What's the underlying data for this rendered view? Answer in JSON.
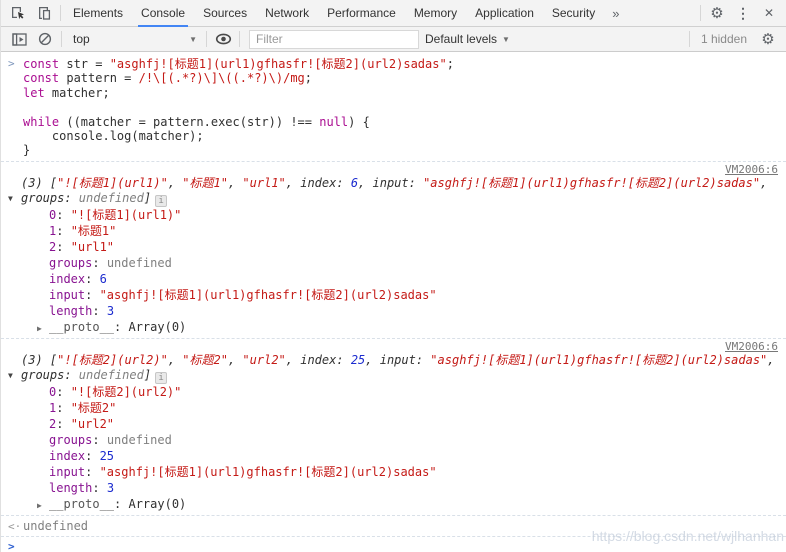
{
  "colors": {
    "accent_blue": "#4285f4",
    "keyword": "#aa0d91",
    "string": "#c41a16",
    "number": "#1c2ccf",
    "property": "#881391",
    "toolbar_bg": "#f3f3f3"
  },
  "icons": {
    "gear": "⚙",
    "kebab": "⋮",
    "close": "✕",
    "overflow_chevron": "»",
    "dropdown_arrow": "▼",
    "collapse_triangle": "▼",
    "expand_triangle": "▶",
    "info": "i",
    "command_chevron": ">",
    "result_marker": "<·",
    "prompt_chevron": ">"
  },
  "devtools": {
    "tabs": [
      "Elements",
      "Console",
      "Sources",
      "Network",
      "Performance",
      "Memory",
      "Application",
      "Security"
    ],
    "active_tab": "Console",
    "toolbar": {
      "context_selector": "top",
      "filter_placeholder": "Filter",
      "levels_label": "Default levels",
      "hidden_count": "1 hidden"
    }
  },
  "console": {
    "command": {
      "lines": [
        [
          {
            "c": "kw",
            "v": "const"
          },
          {
            "c": "pl",
            "v": " str = "
          },
          {
            "c": "str",
            "v": "\"asghfj![标题1](url1)gfhasfr![标题2](url2)sadas\""
          },
          {
            "c": "pl",
            "v": ";"
          }
        ],
        [
          {
            "c": "kw",
            "v": "const"
          },
          {
            "c": "pl",
            "v": " pattern = "
          },
          {
            "c": "rgx",
            "v": "/!\\[(.*?)\\]\\((.*?)\\)/mg"
          },
          {
            "c": "pl",
            "v": ";"
          }
        ],
        [
          {
            "c": "kw",
            "v": "let"
          },
          {
            "c": "pl",
            "v": " matcher;"
          }
        ],
        [],
        [
          {
            "c": "kw",
            "v": "while"
          },
          {
            "c": "pl",
            "v": " ((matcher = pattern.exec(str)) !== "
          },
          {
            "c": "kw",
            "v": "null"
          },
          {
            "c": "pl",
            "v": ") {"
          }
        ],
        [
          {
            "c": "pl",
            "v": "    console.log(matcher);"
          }
        ],
        [
          {
            "c": "pl",
            "v": "}"
          }
        ]
      ]
    },
    "messages": [
      {
        "source_link": "VM2006:6",
        "preview": [
          {
            "c": "pl",
            "v": "(3) ["
          },
          {
            "c": "str",
            "v": "\"![标题1](url1)\""
          },
          {
            "c": "pl",
            "v": ", "
          },
          {
            "c": "str",
            "v": "\"标题1\""
          },
          {
            "c": "pl",
            "v": ", "
          },
          {
            "c": "str",
            "v": "\"url1\""
          },
          {
            "c": "pl",
            "v": ", index: "
          },
          {
            "c": "num",
            "v": "6"
          },
          {
            "c": "pl",
            "v": ", input: "
          },
          {
            "c": "str",
            "v": "\"asghfj![标题1](url1)gfhasfr![标题2](url2)sadas\""
          },
          {
            "c": "pl",
            "v": ", groups: "
          },
          {
            "c": "und",
            "v": "undefined"
          },
          {
            "c": "pl",
            "v": "]"
          }
        ],
        "rows": [
          {
            "key": "0",
            "kc": "key",
            "val": "\"![标题1](url1)\"",
            "vc": "str"
          },
          {
            "key": "1",
            "kc": "key",
            "val": "\"标题1\"",
            "vc": "str"
          },
          {
            "key": "2",
            "kc": "key",
            "val": "\"url1\"",
            "vc": "str"
          },
          {
            "key": "groups",
            "kc": "key",
            "val": "undefined",
            "vc": "und"
          },
          {
            "key": "index",
            "kc": "key",
            "val": "6",
            "vc": "num"
          },
          {
            "key": "input",
            "kc": "key",
            "val": "\"asghfj![标题1](url1)gfhasfr![标题2](url2)sadas\"",
            "vc": "str"
          },
          {
            "key": "length",
            "kc": "key",
            "val": "3",
            "vc": "num"
          },
          {
            "key": "__proto__",
            "kc": "proto",
            "val": "Array(0)",
            "vc": "pl",
            "arrow": true
          }
        ]
      },
      {
        "source_link": "VM2006:6",
        "preview": [
          {
            "c": "pl",
            "v": "(3) ["
          },
          {
            "c": "str",
            "v": "\"![标题2](url2)\""
          },
          {
            "c": "pl",
            "v": ", "
          },
          {
            "c": "str",
            "v": "\"标题2\""
          },
          {
            "c": "pl",
            "v": ", "
          },
          {
            "c": "str",
            "v": "\"url2\""
          },
          {
            "c": "pl",
            "v": ", index: "
          },
          {
            "c": "num",
            "v": "25"
          },
          {
            "c": "pl",
            "v": ", input: "
          },
          {
            "c": "str",
            "v": "\"asghfj![标题1](url1)gfhasfr![标题2](url2)sadas\""
          },
          {
            "c": "pl",
            "v": ", groups: "
          },
          {
            "c": "und",
            "v": "undefined"
          },
          {
            "c": "pl",
            "v": "]"
          }
        ],
        "rows": [
          {
            "key": "0",
            "kc": "key",
            "val": "\"![标题2](url2)\"",
            "vc": "str"
          },
          {
            "key": "1",
            "kc": "key",
            "val": "\"标题2\"",
            "vc": "str"
          },
          {
            "key": "2",
            "kc": "key",
            "val": "\"url2\"",
            "vc": "str"
          },
          {
            "key": "groups",
            "kc": "key",
            "val": "undefined",
            "vc": "und"
          },
          {
            "key": "index",
            "kc": "key",
            "val": "25",
            "vc": "num"
          },
          {
            "key": "input",
            "kc": "key",
            "val": "\"asghfj![标题1](url1)gfhasfr![标题2](url2)sadas\"",
            "vc": "str"
          },
          {
            "key": "length",
            "kc": "key",
            "val": "3",
            "vc": "num"
          },
          {
            "key": "__proto__",
            "kc": "proto",
            "val": "Array(0)",
            "vc": "pl",
            "arrow": true
          }
        ]
      }
    ],
    "result_value": "undefined",
    "watermark": "https://blog.csdn.net/wjlhanhan"
  }
}
